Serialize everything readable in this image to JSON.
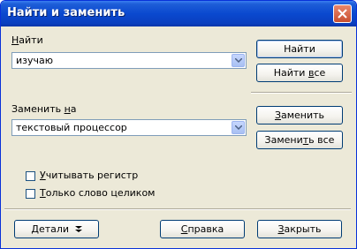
{
  "window": {
    "title": "Найти и заменить"
  },
  "find": {
    "label_first": "Н",
    "label_rest": "айти",
    "value": "изучаю"
  },
  "replace": {
    "label_pre": "Заменить ",
    "label_u": "н",
    "label_post": "а",
    "value": "текстовый процессор"
  },
  "options": {
    "match_case_u": "У",
    "match_case_rest": "читывать регистр",
    "whole_word_u": "Т",
    "whole_word_rest": "олько слово целиком",
    "match_case_checked": false,
    "whole_word_checked": false
  },
  "buttons": {
    "find": "Найти",
    "find_all_pre": "Найти ",
    "find_all_u": "в",
    "find_all_post": "се",
    "replace_u": "З",
    "replace_rest": "аменить",
    "replace_all_pre": "Замени",
    "replace_all_u": "т",
    "replace_all_post": "ь все",
    "details": "Детали",
    "help_u": "С",
    "help_rest": "правка",
    "close_u": "З",
    "close_rest": "акрыть"
  }
}
